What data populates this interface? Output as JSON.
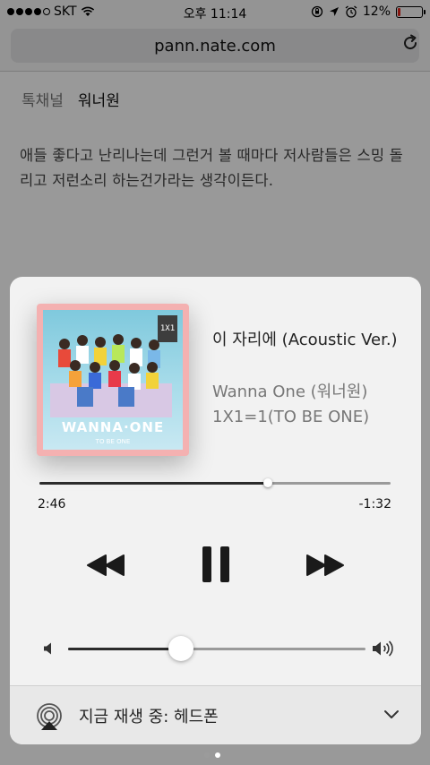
{
  "status_bar": {
    "carrier": "SKT",
    "time": "오후 11:14",
    "battery_percent": "12%",
    "battery_level": 0.12,
    "battery_color": "#e0241a"
  },
  "browser": {
    "url": "pann.nate.com",
    "reload_icon": "reload-icon"
  },
  "page": {
    "breadcrumb_parent": "톡채널",
    "breadcrumb_current": "워너원",
    "post_text": "애들 좋다고 난리나는데 그런거 볼 때마다 저사람들은 스밍 돌리고 저런소리 하는건가라는 생각이든다."
  },
  "now_playing": {
    "title": "이 자리에 (Acoustic Ver.)",
    "artist": "Wanna One (워너원)",
    "album": "1X1=1(TO BE ONE)",
    "album_art": {
      "logo": "WANNA·ONE",
      "subtitle": "TO BE ONE",
      "tag": "1X1"
    },
    "elapsed": "2:46",
    "remaining": "-1:32",
    "progress": 0.65,
    "volume": 0.38
  },
  "controls": {
    "rewind_icon": "rewind-icon",
    "pause_icon": "pause-icon",
    "forward_icon": "fast-forward-icon"
  },
  "route": {
    "label": "지금 재생 중: 헤드폰",
    "icon": "airplay-icon"
  },
  "pager": {
    "count": 2,
    "active": 1
  }
}
